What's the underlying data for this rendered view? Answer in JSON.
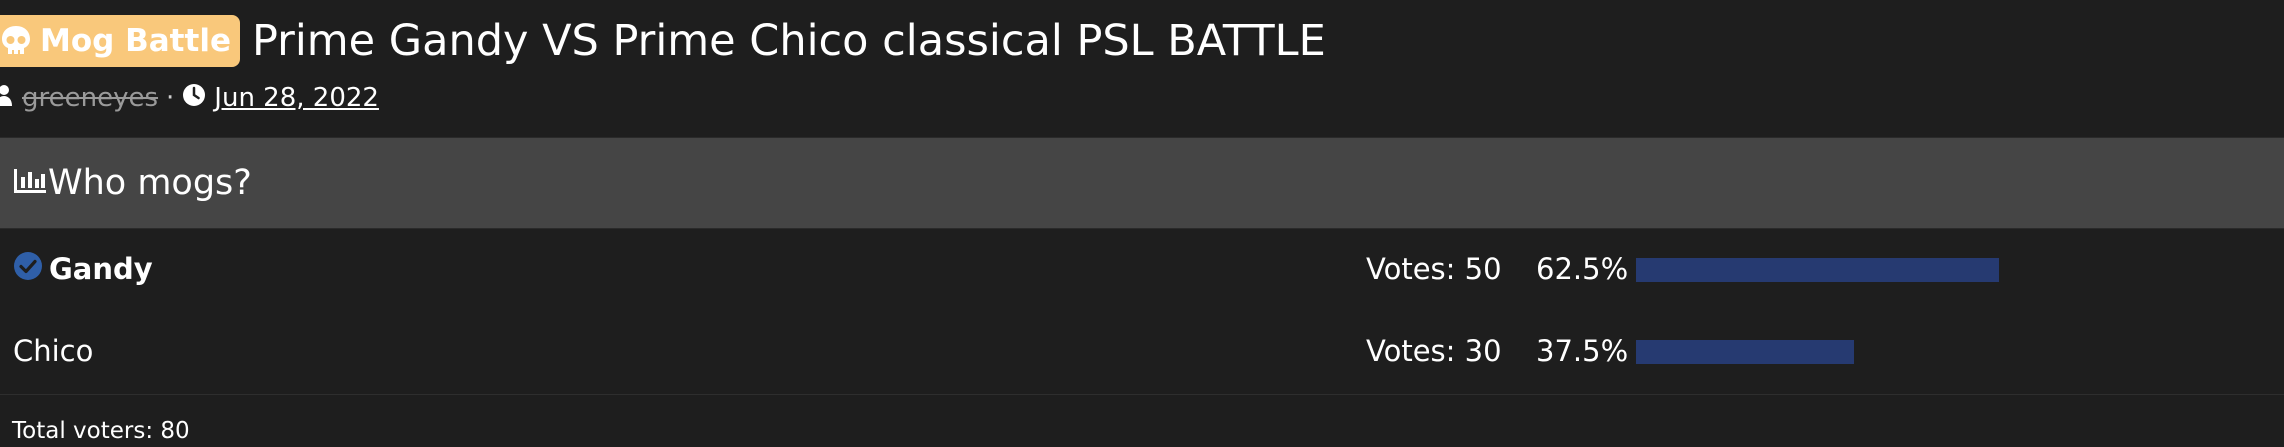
{
  "thread": {
    "prefix": "Mog Battle",
    "title": "Prime Gandy VS Prime Chico classical PSL BATTLE",
    "author": "greeneyes",
    "separator": "·",
    "date": "Jun 28, 2022"
  },
  "poll": {
    "title": "Who mogs?",
    "options": [
      {
        "label": "Gandy",
        "votes_text": "Votes: 50",
        "votes": 50,
        "percent_text": "62.5%",
        "percent": 62.5,
        "voted": true
      },
      {
        "label": "Chico",
        "votes_text": "Votes: 30",
        "votes": 30,
        "percent_text": "37.5%",
        "percent": 37.5,
        "voted": false
      }
    ],
    "total_text": "Total voters: 80"
  },
  "colors": {
    "prefix_bg": "#f9c87b",
    "bar": "#263a71",
    "check": "#2f5fa8"
  },
  "icons": {
    "prefix": "skull-icon",
    "author": "user-icon",
    "date": "clock-icon",
    "poll": "bar-chart-icon",
    "voted": "check-circle-icon"
  }
}
